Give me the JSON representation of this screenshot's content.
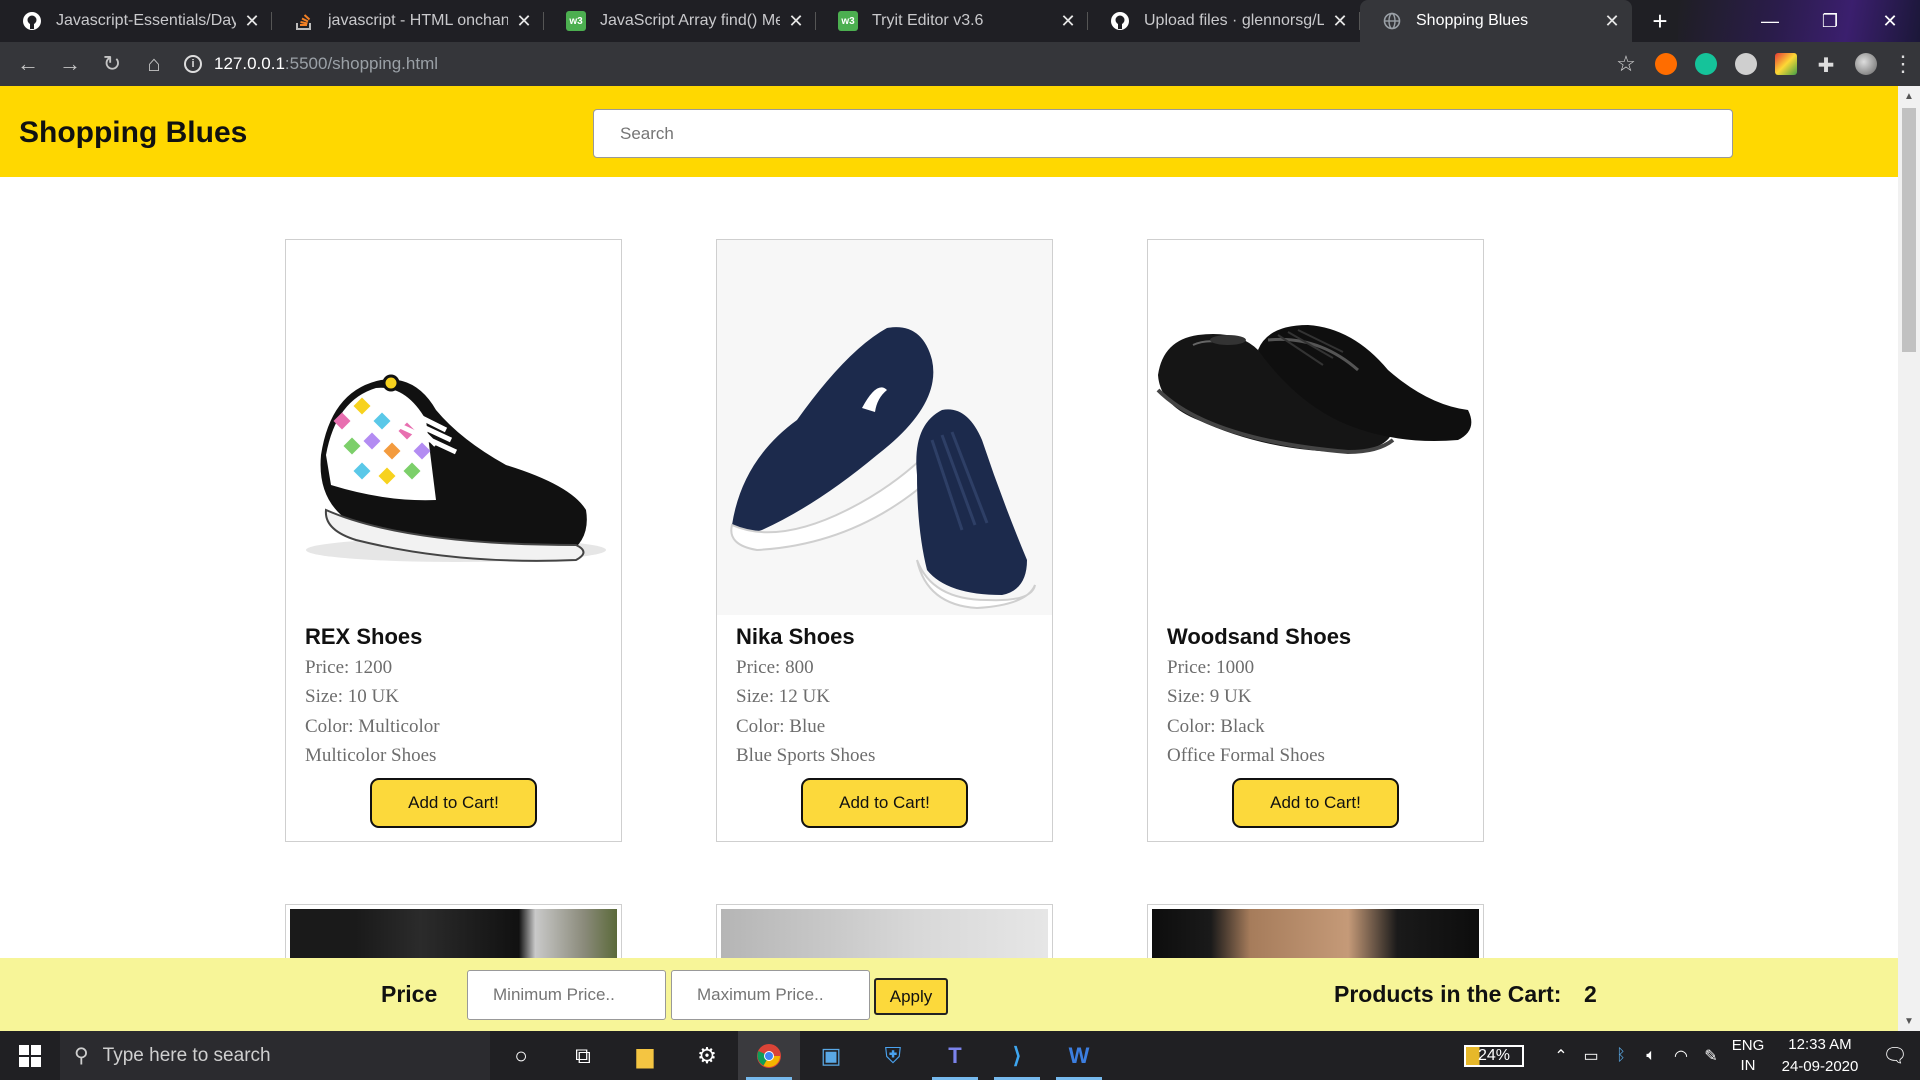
{
  "browser": {
    "tabs": [
      {
        "title": "Javascript-Essentials/Day 8 A",
        "icon": "github-icon",
        "active": false
      },
      {
        "title": "javascript - HTML onchange",
        "icon": "stackoverflow-icon",
        "active": false
      },
      {
        "title": "JavaScript Array find() Metho",
        "icon": "w3schools-icon",
        "active": false
      },
      {
        "title": "Tryit Editor v3.6",
        "icon": "w3schools-icon",
        "active": false
      },
      {
        "title": "Upload files · glennorsg/Lets",
        "icon": "github-icon",
        "active": false
      },
      {
        "title": "Shopping Blues",
        "icon": "globe-icon",
        "active": true
      }
    ],
    "url_host": "127.0.0.1",
    "url_path": ":5500/shopping.html"
  },
  "site": {
    "title": "Shopping Blues",
    "search_placeholder": "Search"
  },
  "products": [
    {
      "name": "REX Shoes",
      "price": "Price: 1200",
      "size": "Size: 10 UK",
      "color": "Color: Multicolor",
      "desc": "Multicolor Shoes",
      "button": "Add to Cart!"
    },
    {
      "name": "Nika Shoes",
      "price": "Price: 800",
      "size": "Size: 12 UK",
      "color": "Color: Blue",
      "desc": "Blue Sports Shoes",
      "button": "Add to Cart!"
    },
    {
      "name": "Woodsand Shoes",
      "price": "Price: 1000",
      "size": "Size: 9 UK",
      "color": "Color: Black",
      "desc": "Office Formal Shoes",
      "button": "Add to Cart!"
    }
  ],
  "filter": {
    "label": "Price",
    "min_placeholder": "Minimum Price..",
    "max_placeholder": "Maximum Price..",
    "apply": "Apply",
    "cart_label": "Products in the Cart:",
    "cart_count": "2"
  },
  "taskbar": {
    "search_placeholder": "Type here to search",
    "battery": "24%",
    "lang_top": "ENG",
    "lang_bottom": "IN",
    "time": "12:33 AM",
    "date": "24-09-2020"
  },
  "colors": {
    "header_bg": "#ffd800",
    "button_bg": "#fcd93b",
    "filter_bg": "#f7f598"
  }
}
